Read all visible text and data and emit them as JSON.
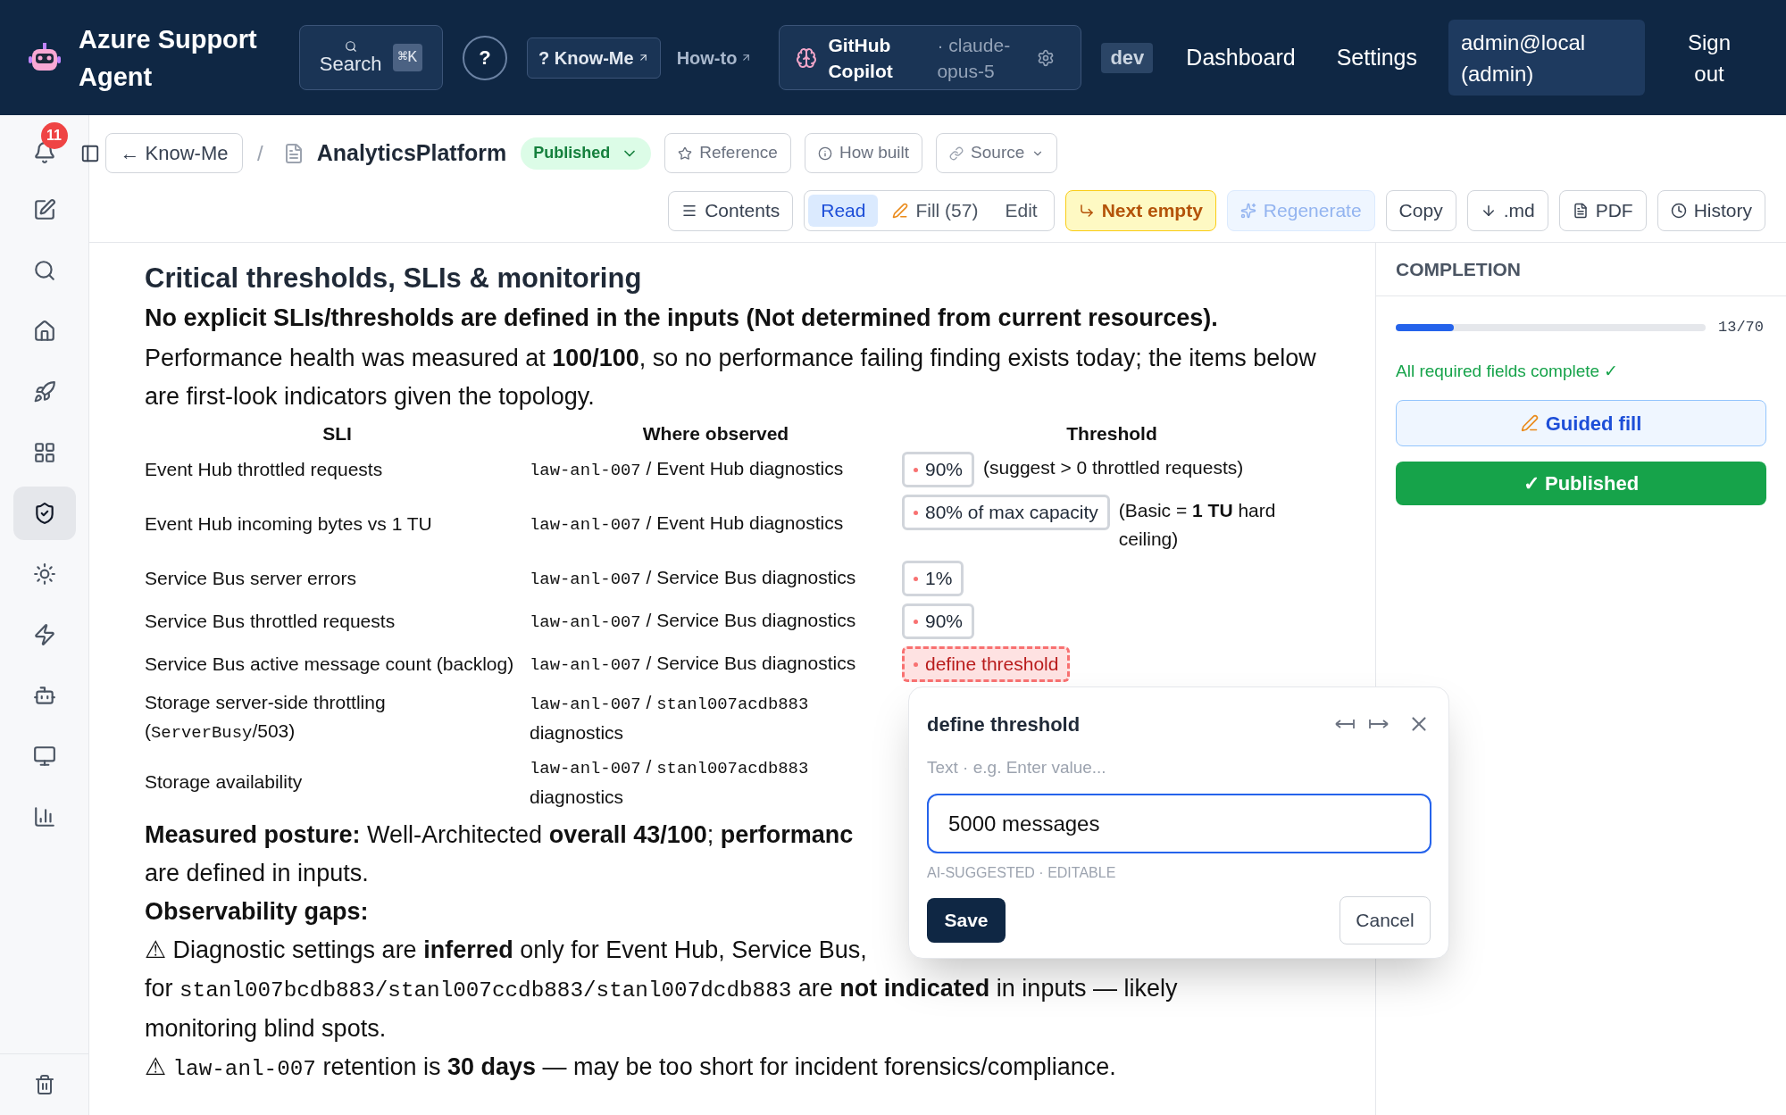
{
  "header": {
    "title": "Azure Support Agent",
    "search": {
      "label": "Search",
      "shortcut": "⌘K"
    },
    "help": "?",
    "links": [
      {
        "label": "? Know-Me",
        "boxed": true
      },
      {
        "label": "How-to",
        "boxed": false
      }
    ],
    "model": {
      "provider": "GitHub Copilot",
      "name": "· claude-opus-5"
    },
    "env": "dev",
    "nav": [
      "Dashboard",
      "Settings"
    ],
    "user": "admin@local (admin)",
    "sign_out": "Sign out"
  },
  "sidebar": {
    "notifications": "11",
    "items": [
      {
        "kind": "edit",
        "selected": false
      },
      {
        "kind": "search",
        "selected": false
      },
      {
        "kind": "home",
        "selected": false
      },
      {
        "kind": "rocket",
        "selected": false
      },
      {
        "kind": "grid",
        "selected": false
      },
      {
        "kind": "shield",
        "selected": true
      },
      {
        "kind": "sun",
        "selected": false
      },
      {
        "kind": "bolt",
        "selected": false
      },
      {
        "kind": "bot",
        "selected": false
      },
      {
        "kind": "monitor",
        "selected": false
      },
      {
        "kind": "chart",
        "selected": false
      }
    ]
  },
  "toolbar": {
    "back": "← Know-Me",
    "separator": "/",
    "doc_title": "AnalyticsPlatform",
    "status": "Published",
    "links": [
      {
        "label": "Reference",
        "kind": "star"
      },
      {
        "label": "How built",
        "kind": "info"
      },
      {
        "label": "Source",
        "kind": "link"
      }
    ],
    "contents": "Contents",
    "modes": [
      {
        "label": "Read",
        "selected": true
      },
      {
        "label": "Fill (57)",
        "selected": false
      },
      {
        "label": "Edit",
        "selected": false
      }
    ],
    "actions": [
      {
        "label": "Next empty",
        "kind": "next",
        "disabled": false
      },
      {
        "label": "Regenerate",
        "kind": "regenerate",
        "disabled": true
      },
      {
        "label": "Copy",
        "kind": "copy",
        "disabled": false
      },
      {
        "label": ".md",
        "kind": "download",
        "disabled": false
      },
      {
        "label": "PDF",
        "kind": "pdf",
        "disabled": false
      },
      {
        "label": "History",
        "kind": "history",
        "disabled": false
      }
    ]
  },
  "document": {
    "title": "Critical thresholds, SLIs & monitoring",
    "lead": "No explicit SLIs/thresholds are defined in the inputs (Not determined from current resources).",
    "intro": "Performance health was measured at **100/100**, so no performance failing finding exists today; the items below are first-look indicators given the topology.",
    "table": {
      "columns": [
        "SLI",
        "Where observed",
        "Threshold"
      ],
      "rows": [
        {
          "sli": [
            {
              "kind": "text",
              "text": "Event Hub throttled requests"
            }
          ],
          "where": [
            {
              "kind": "code",
              "text": "law-anl-007"
            },
            {
              "kind": "text",
              "text": " / Event Hub diagnostics"
            }
          ],
          "threshold": {
            "value": "90%",
            "kind": "set"
          },
          "note": "(suggest > 0 throttled requests)"
        },
        {
          "sli": [
            {
              "kind": "text",
              "text": "Event Hub incoming bytes vs 1 TU"
            }
          ],
          "where": [
            {
              "kind": "code",
              "text": "law-anl-007"
            },
            {
              "kind": "text",
              "text": " / Event Hub diagnostics"
            }
          ],
          "threshold": {
            "value": "80% of max capacity",
            "kind": "set"
          },
          "note": "(Basic = **1 TU** hard ceiling)"
        },
        {
          "sli": [
            {
              "kind": "text",
              "text": "Service Bus server errors"
            }
          ],
          "where": [
            {
              "kind": "code",
              "text": "law-anl-007"
            },
            {
              "kind": "text",
              "text": " / Service Bus diagnostics"
            }
          ],
          "threshold": {
            "value": "1%",
            "kind": "set"
          }
        },
        {
          "sli": [
            {
              "kind": "text",
              "text": "Service Bus throttled requests"
            }
          ],
          "where": [
            {
              "kind": "code",
              "text": "law-anl-007"
            },
            {
              "kind": "text",
              "text": " / Service Bus diagnostics"
            }
          ],
          "threshold": {
            "value": "90%",
            "kind": "set"
          }
        },
        {
          "sli": [
            {
              "kind": "text",
              "text": "Service Bus active message count (backlog)"
            }
          ],
          "where": [
            {
              "kind": "code",
              "text": "law-anl-007"
            },
            {
              "kind": "text",
              "text": " / Service Bus diagnostics"
            }
          ],
          "threshold": {
            "value": "define threshold",
            "kind": "empty"
          }
        },
        {
          "sli": [
            {
              "kind": "text",
              "text": "Storage server-side throttling ("
            },
            {
              "kind": "code",
              "text": "ServerBusy"
            },
            {
              "kind": "text",
              "text": "/503)"
            }
          ],
          "where": [
            {
              "kind": "code",
              "text": "law-anl-007"
            },
            {
              "kind": "text",
              "text": " / "
            },
            {
              "kind": "code",
              "text": "stanl007acdb883"
            },
            {
              "kind": "text",
              "text": " diagnostics"
            }
          ]
        },
        {
          "sli": [
            {
              "kind": "text",
              "text": "Storage availability"
            }
          ],
          "where": [
            {
              "kind": "code",
              "text": "law-anl-007"
            },
            {
              "kind": "text",
              "text": " / "
            },
            {
              "kind": "code",
              "text": "stanl007acdb883"
            },
            {
              "kind": "text",
              "text": " diagnostics"
            }
          ]
        }
      ]
    },
    "after": [
      [
        {
          "kind": "text",
          "text": "**Measured posture:** Well-Architected **overall 43/100**; **performanc**"
        }
      ],
      [
        {
          "kind": "text",
          "text": "are defined in inputs."
        }
      ],
      [
        {
          "kind": "text",
          "text": "**Observability gaps:**"
        }
      ],
      [
        {
          "kind": "text",
          "text": "⚠ Diagnostic settings are **inferred** only for Event Hub, Service Bus,"
        }
      ],
      [
        {
          "kind": "text",
          "text": "for "
        },
        {
          "kind": "code",
          "text": "stanl007bcdb883/stanl007ccdb883/stanl007dcdb883"
        },
        {
          "kind": "text",
          "text": " are **not indicated** in inputs — likely"
        }
      ],
      [
        {
          "kind": "text",
          "text": "monitoring blind spots."
        }
      ],
      [
        {
          "kind": "text",
          "text": "⚠ "
        },
        {
          "kind": "code",
          "text": "law-anl-007"
        },
        {
          "kind": "text",
          "text": " retention is **30 days** — may be too short for incident forensics/compliance."
        }
      ]
    ]
  },
  "completion": {
    "title": "COMPLETION",
    "level": 0.186,
    "count": "13/70",
    "status": "All required fields complete ✓",
    "guided_fill": "Guided fill",
    "publish": "✓ Published"
  },
  "popup": {
    "title": "define threshold",
    "hint": "Text · e.g. Enter value...",
    "value": "5000 messages",
    "note": "AI-SUGGESTED · EDITABLE",
    "save": "Save",
    "cancel": "Cancel"
  }
}
